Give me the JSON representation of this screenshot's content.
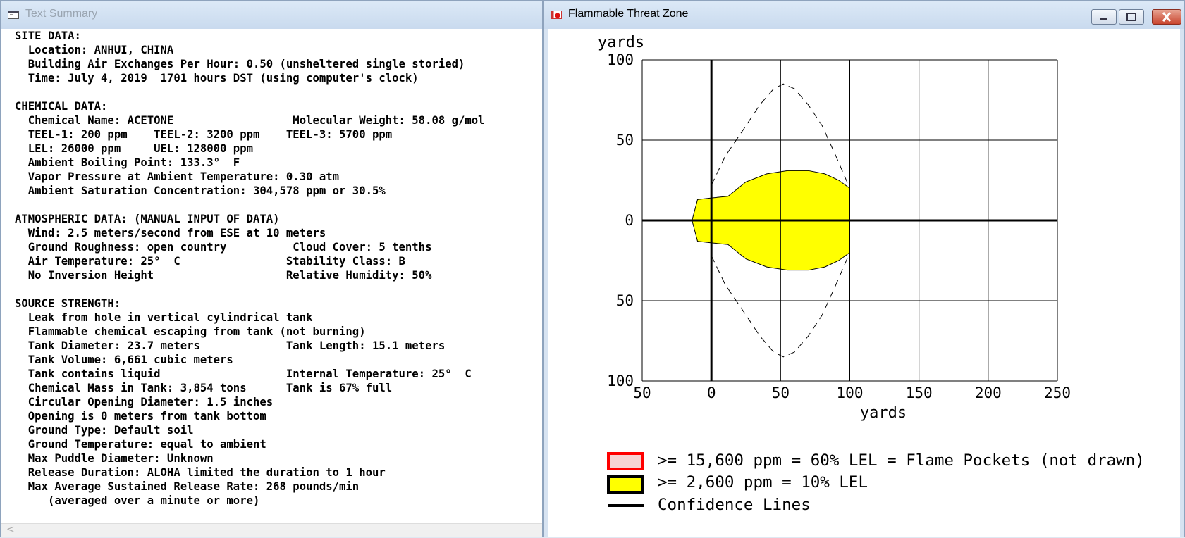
{
  "left_window": {
    "title": "Text Summary",
    "lines": [
      "SITE DATA:",
      "  Location: ANHUI, CHINA",
      "  Building Air Exchanges Per Hour: 0.50 (unsheltered single storied)",
      "  Time: July 4, 2019  1701 hours DST (using computer's clock)",
      "",
      "CHEMICAL DATA:",
      "  Chemical Name: ACETONE                  Molecular Weight: 58.08 g/mol",
      "  TEEL-1: 200 ppm    TEEL-2: 3200 ppm    TEEL-3: 5700 ppm",
      "  LEL: 26000 ppm     UEL: 128000 ppm",
      "  Ambient Boiling Point: 133.3°  F",
      "  Vapor Pressure at Ambient Temperature: 0.30 atm",
      "  Ambient Saturation Concentration: 304,578 ppm or 30.5%",
      "",
      "ATMOSPHERIC DATA: (MANUAL INPUT OF DATA)",
      "  Wind: 2.5 meters/second from ESE at 10 meters",
      "  Ground Roughness: open country          Cloud Cover: 5 tenths",
      "  Air Temperature: 25°  C                Stability Class: B",
      "  No Inversion Height                    Relative Humidity: 50%",
      "",
      "SOURCE STRENGTH:",
      "  Leak from hole in vertical cylindrical tank",
      "  Flammable chemical escaping from tank (not burning)",
      "  Tank Diameter: 23.7 meters             Tank Length: 15.1 meters",
      "  Tank Volume: 6,661 cubic meters",
      "  Tank contains liquid                   Internal Temperature: 25°  C",
      "  Chemical Mass in Tank: 3,854 tons      Tank is 67% full",
      "  Circular Opening Diameter: 1.5 inches",
      "  Opening is 0 meters from tank bottom",
      "  Ground Type: Default soil",
      "  Ground Temperature: equal to ambient",
      "  Max Puddle Diameter: Unknown",
      "  Release Duration: ALOHA limited the duration to 1 hour",
      "  Max Average Sustained Release Rate: 268 pounds/min",
      "     (averaged over a minute or more)"
    ],
    "scroll_arrow": "<"
  },
  "right_window": {
    "title": "Flammable Threat Zone",
    "y_unit": "yards",
    "x_unit": "yards",
    "y_ticks": [
      "100",
      "50",
      "0",
      "50",
      "100"
    ],
    "x_ticks": [
      "50",
      "0",
      "50",
      "100",
      "150",
      "200",
      "250"
    ],
    "colors": {
      "flame_pockets": "#ff0000",
      "lel10_zone": "#ffff00",
      "confidence_lines": "#000000"
    },
    "legend": [
      {
        "text": ">= 15,600 ppm = 60% LEL = Flame Pockets (not drawn)"
      },
      {
        "text": ">= 2,600 ppm = 10% LEL"
      },
      {
        "text": "Confidence Lines"
      }
    ]
  },
  "chart_data": {
    "type": "area",
    "x_range": [
      -50,
      250
    ],
    "y_range": [
      -100,
      100
    ],
    "grid": true,
    "series": [
      {
        "name": ">= 2,600 ppm = 10% LEL",
        "x": [
          -14,
          -10,
          0,
          12,
          25,
          40,
          55,
          70,
          82,
          92,
          100
        ],
        "y_upper": [
          0,
          13,
          14,
          15,
          24,
          29,
          31,
          31,
          29,
          25,
          20
        ]
      },
      {
        "name": "Confidence Lines",
        "x": [
          0,
          10,
          25,
          35,
          45,
          52,
          60,
          70,
          80,
          90,
          96,
          100
        ],
        "y_upper": [
          22,
          40,
          59,
          72,
          82,
          85,
          82,
          72,
          59,
          40,
          28,
          20
        ]
      }
    ]
  },
  "window_controls": {
    "minimize": "minimize",
    "maximize": "maximize",
    "close": "close"
  }
}
